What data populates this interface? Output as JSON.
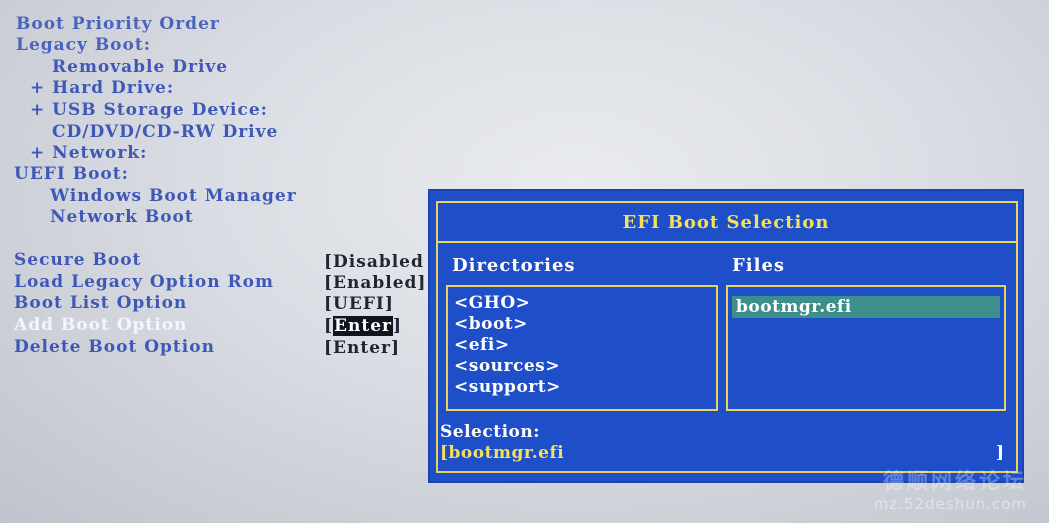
{
  "boot_list": {
    "priority_order": "Boot Priority Order",
    "legacy_boot": "Legacy Boot:",
    "removable_drive": "Removable Drive",
    "hard_drive": "+ Hard Drive:",
    "usb_storage": "+ USB Storage Device:",
    "cd_drive": "CD/DVD/CD-RW Drive",
    "network": "+ Network:",
    "uefi_boot": "UEFI Boot:",
    "windows_boot_manager": "Windows Boot Manager",
    "network_boot": "Network Boot"
  },
  "settings": [
    {
      "label": "Secure Boot",
      "value": "[Disabled"
    },
    {
      "label": "Load Legacy Option Rom",
      "value": "[Enabled]"
    },
    {
      "label": "Boot List Option",
      "value": "[UEFI]"
    },
    {
      "label": "Add Boot Option",
      "value_open": "[",
      "value_text": "Enter",
      "value_close": "]"
    },
    {
      "label": "Delete Boot Option",
      "value": "[Enter]"
    }
  ],
  "efi_dialog": {
    "title": "EFI Boot Selection",
    "directories_header": "Directories",
    "files_header": "Files",
    "directories": [
      "<GHO>",
      "<boot>",
      "<efi>",
      "<sources>",
      "<support>"
    ],
    "files": [
      "bootmgr.efi"
    ],
    "selection_label": "Selection:",
    "selection_value": "[bootmgr.efi",
    "selection_close": "]"
  },
  "watermark": {
    "site_name": "德顺网络论坛",
    "url": "mz.52deshun.com"
  },
  "colors": {
    "dialog_bg": "#1f4fc8",
    "dialog_border": "#e8d25a",
    "highlight": "#3e8f8b",
    "menu_text": "#3f58b8"
  }
}
